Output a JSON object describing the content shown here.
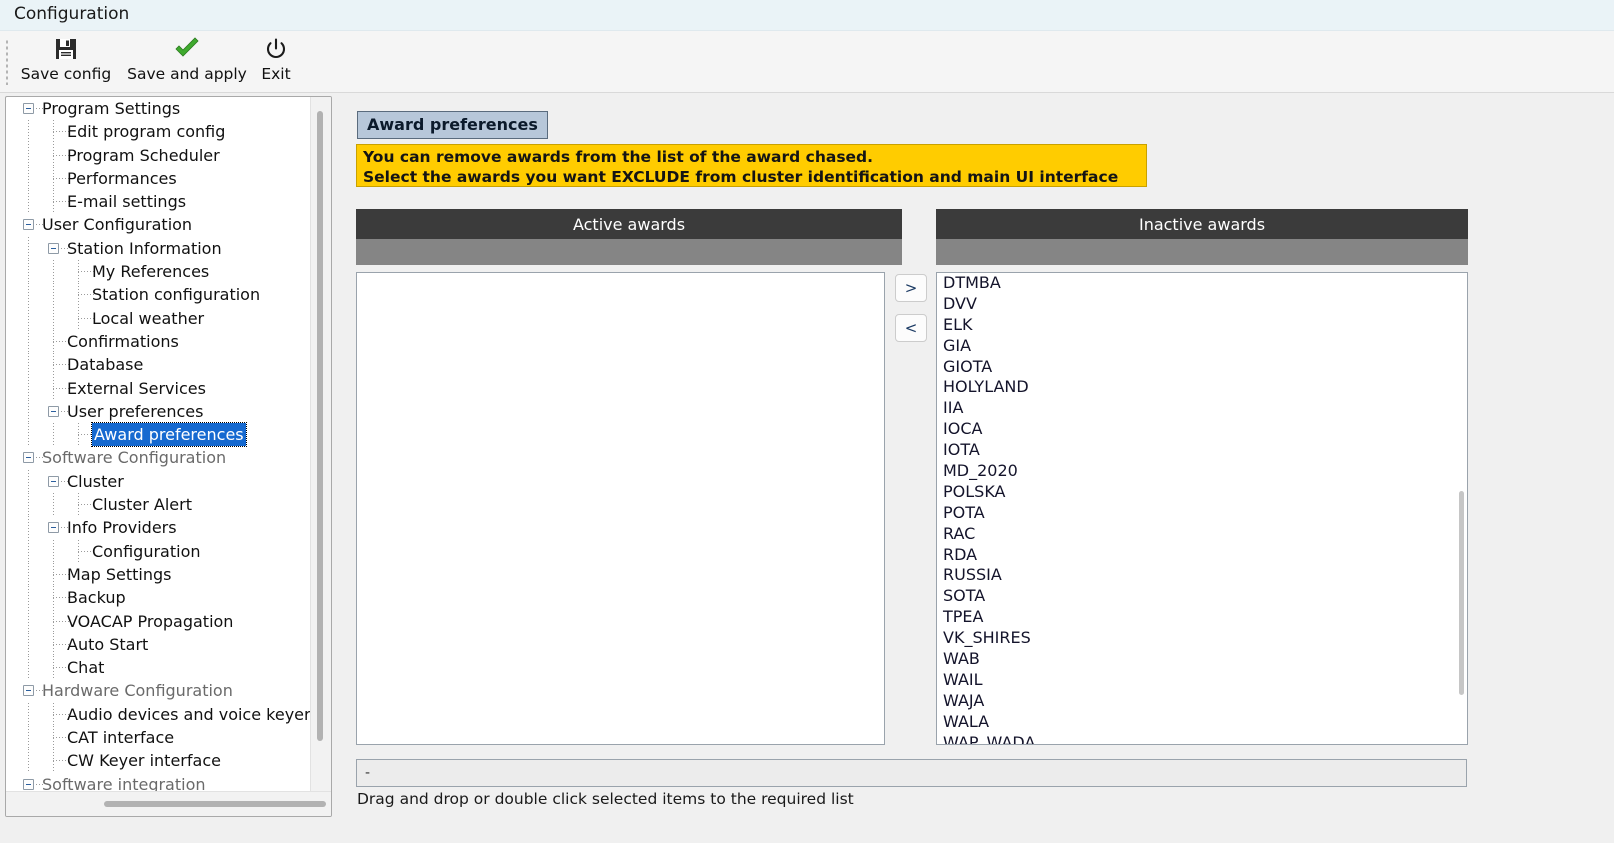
{
  "window": {
    "title": "Configuration"
  },
  "toolbar": {
    "buttons": [
      {
        "label": "Save config",
        "icon": "floppy-disk-icon"
      },
      {
        "label": "Save and apply",
        "icon": "green-check-icon"
      },
      {
        "label": "Exit",
        "icon": "power-icon"
      }
    ]
  },
  "sidebar": {
    "items": [
      {
        "label": "Program Settings",
        "level": 0,
        "expander": true,
        "dim": false,
        "selected": false
      },
      {
        "label": "Edit program config",
        "level": 1,
        "expander": false,
        "dim": false,
        "selected": false
      },
      {
        "label": "Program Scheduler",
        "level": 1,
        "expander": false,
        "dim": false,
        "selected": false
      },
      {
        "label": "Performances",
        "level": 1,
        "expander": false,
        "dim": false,
        "selected": false
      },
      {
        "label": "E-mail settings",
        "level": 1,
        "expander": false,
        "dim": false,
        "selected": false
      },
      {
        "label": "User Configuration",
        "level": 0,
        "expander": true,
        "dim": false,
        "selected": false
      },
      {
        "label": "Station Information",
        "level": 1,
        "expander": true,
        "dim": false,
        "selected": false
      },
      {
        "label": "My References",
        "level": 2,
        "expander": false,
        "dim": false,
        "selected": false
      },
      {
        "label": "Station configuration",
        "level": 2,
        "expander": false,
        "dim": false,
        "selected": false
      },
      {
        "label": "Local weather",
        "level": 2,
        "expander": false,
        "dim": false,
        "selected": false
      },
      {
        "label": "Confirmations",
        "level": 1,
        "expander": false,
        "dim": false,
        "selected": false
      },
      {
        "label": "Database",
        "level": 1,
        "expander": false,
        "dim": false,
        "selected": false
      },
      {
        "label": "External Services",
        "level": 1,
        "expander": false,
        "dim": false,
        "selected": false
      },
      {
        "label": "User preferences",
        "level": 1,
        "expander": true,
        "dim": false,
        "selected": false
      },
      {
        "label": "Award preferences",
        "level": 2,
        "expander": false,
        "dim": false,
        "selected": true
      },
      {
        "label": "Software Configuration",
        "level": 0,
        "expander": true,
        "dim": true,
        "selected": false
      },
      {
        "label": "Cluster",
        "level": 1,
        "expander": true,
        "dim": false,
        "selected": false
      },
      {
        "label": "Cluster Alert",
        "level": 2,
        "expander": false,
        "dim": false,
        "selected": false
      },
      {
        "label": "Info Providers",
        "level": 1,
        "expander": true,
        "dim": false,
        "selected": false
      },
      {
        "label": "Configuration",
        "level": 2,
        "expander": false,
        "dim": false,
        "selected": false
      },
      {
        "label": "Map Settings",
        "level": 1,
        "expander": false,
        "dim": false,
        "selected": false
      },
      {
        "label": "Backup",
        "level": 1,
        "expander": false,
        "dim": false,
        "selected": false
      },
      {
        "label": "VOACAP Propagation",
        "level": 1,
        "expander": false,
        "dim": false,
        "selected": false
      },
      {
        "label": "Auto Start",
        "level": 1,
        "expander": false,
        "dim": false,
        "selected": false
      },
      {
        "label": "Chat",
        "level": 1,
        "expander": false,
        "dim": false,
        "selected": false
      },
      {
        "label": "Hardware Configuration",
        "level": 0,
        "expander": true,
        "dim": true,
        "selected": false
      },
      {
        "label": "Audio devices and voice keyer",
        "level": 1,
        "expander": false,
        "dim": false,
        "selected": false
      },
      {
        "label": "CAT interface",
        "level": 1,
        "expander": false,
        "dim": false,
        "selected": false
      },
      {
        "label": "CW Keyer interface",
        "level": 1,
        "expander": false,
        "dim": false,
        "selected": false
      },
      {
        "label": "Software integration",
        "level": 0,
        "expander": true,
        "dim": true,
        "selected": false
      }
    ]
  },
  "main": {
    "page_title": "Award preferences",
    "notice_line1": "You can remove awards from the list of the award chased.",
    "notice_line2": "Select the awards you want EXCLUDE from cluster identification and main UI interface",
    "active_header": "Active awards",
    "inactive_header": "Inactive awards",
    "active_items": [],
    "inactive_items": [
      "DTMBA",
      "DVV",
      "ELK",
      "GIA",
      "GIOTA",
      "HOLYLAND",
      "IIA",
      "IOCA",
      "IOTA",
      "MD_2020",
      "POLSKA",
      "POTA",
      "RAC",
      "RDA",
      "RUSSIA",
      "SOTA",
      "TPEA",
      "VK_SHIRES",
      "WAB",
      "WAIL",
      "WAJA",
      "WALA",
      "WAP_WADA"
    ],
    "move_right_label": ">",
    "move_left_label": "<",
    "status_text": "-",
    "hint_text": "Drag and drop or double click selected items to the required list"
  },
  "colors": {
    "titlebar_bg": "#eaf3f7",
    "notice_bg": "#ffcc00",
    "column_header_bg": "#3b3b3b",
    "column_sub_bg": "#858585",
    "selection_blue": "#1569d0",
    "badge_bg": "#b7c7d9"
  }
}
